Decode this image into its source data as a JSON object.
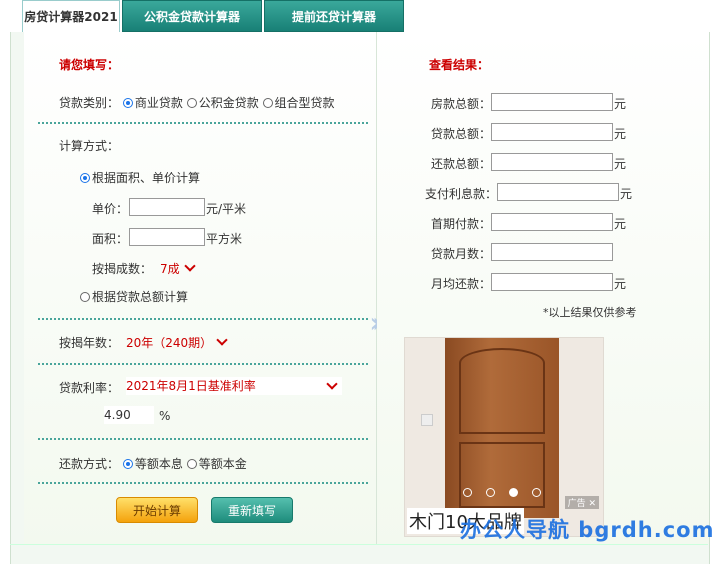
{
  "tabs": [
    {
      "label": "房贷计算器2021",
      "active": true
    },
    {
      "label": "公积金贷款计算器",
      "active": false
    },
    {
      "label": "提前还贷计算器",
      "active": false
    }
  ],
  "left": {
    "header": "请您填写：",
    "loan_type": {
      "label": "贷款类别：",
      "options": [
        "商业贷款",
        "公积金贷款",
        "组合型贷款"
      ],
      "selected": 0
    },
    "calc_method": {
      "label": "计算方式："
    },
    "method1": {
      "label": "根据面积、单价计算",
      "selected": true
    },
    "unit_price": {
      "label": "单价：",
      "unit": "元/平米",
      "value": ""
    },
    "area": {
      "label": "面积：",
      "unit": "平方米",
      "value": ""
    },
    "down_ratio": {
      "label": "按揭成数：",
      "value": "7成"
    },
    "method2": {
      "label": "根据贷款总额计算",
      "selected": false
    },
    "years": {
      "label": "按揭年数：",
      "value": "20年（240期）"
    },
    "rate": {
      "label": "贷款利率：",
      "value": "2021年8月1日基准利率"
    },
    "rate_value": {
      "value": "4.90",
      "unit": "%"
    },
    "repay": {
      "label": "还款方式：",
      "options": [
        "等额本息",
        "等额本金"
      ],
      "selected": 0
    },
    "buttons": {
      "calc": "开始计算",
      "reset": "重新填写"
    }
  },
  "right": {
    "header": "查看结果：",
    "fields": [
      {
        "label": "房款总额：",
        "unit": "元"
      },
      {
        "label": "贷款总额：",
        "unit": "元"
      },
      {
        "label": "还款总额：",
        "unit": "元"
      },
      {
        "label": "支付利息款：",
        "unit": "元"
      },
      {
        "label": "首期付款：",
        "unit": "元"
      },
      {
        "label": "贷款月数：",
        "unit": ""
      },
      {
        "label": "月均还款：",
        "unit": "元"
      }
    ],
    "note": "*以上结果仅供参考"
  },
  "ad": {
    "caption": "木门10大品牌",
    "tag": "广告",
    "close": "✕",
    "dots": 4,
    "active_dot": 2
  },
  "watermark": "办公人导航 bgrdh.com"
}
